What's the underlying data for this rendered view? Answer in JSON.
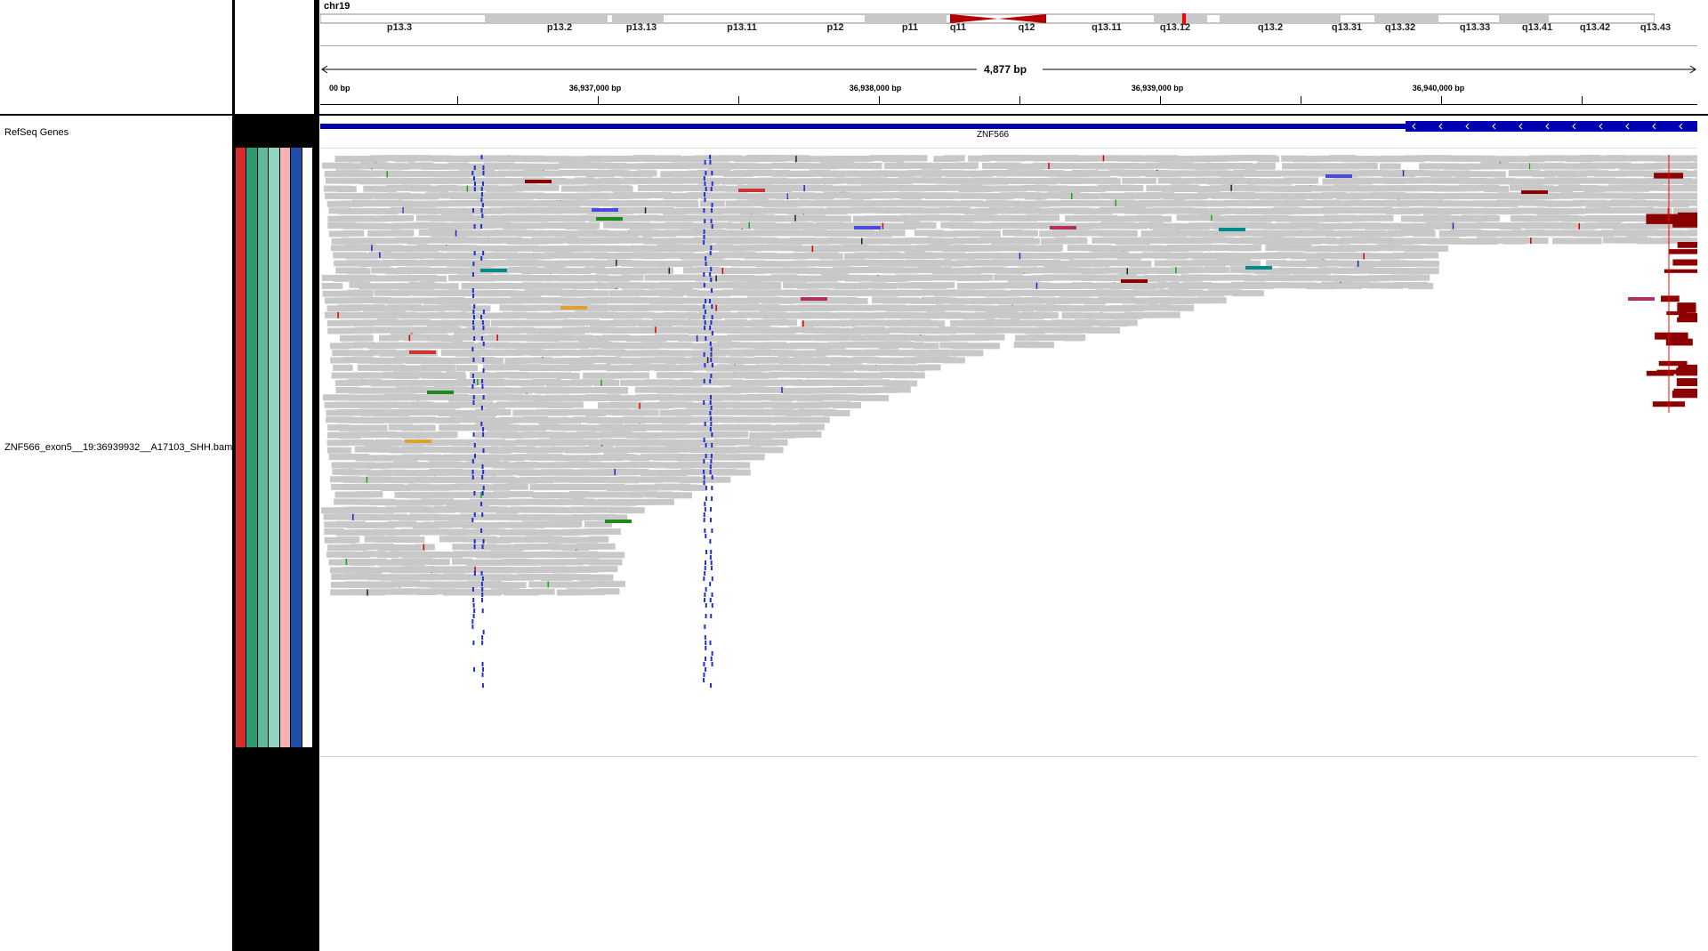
{
  "chromosome": "chr19",
  "cytobands": [
    "p13.3",
    "p13.2",
    "p13.13",
    "p13.11",
    "p12",
    "p11",
    "q11",
    "q12",
    "q13.11",
    "q13.12",
    "q13.2",
    "q13.31",
    "q13.32",
    "q13.33",
    "q13.41",
    "q13.42",
    "q13.43"
  ],
  "ruler": {
    "span_label": "4,877 bp",
    "ticks": [
      "00 bp",
      "36,937,000 bp",
      "36,938,000 bp",
      "36,939,000 bp",
      "36,940,000 bp"
    ]
  },
  "tracks": {
    "gene_track_name": "RefSeq Genes",
    "gene_name": "ZNF566",
    "alignment_track_name": "ZNF566_exon5__19:36939932__A17103_SHH.bam"
  },
  "colors": {
    "gene": "#0000b2",
    "read": "#c8c8c8",
    "centromere": "#b40000",
    "indicator": "#ff0000",
    "attr_red": "#d82b2b",
    "attr_green": "#2e9a6e",
    "attr_mint": "#8fd3c0",
    "attr_pink": "#f4b3b0",
    "attr_blue": "#1f4fa8",
    "mismatch_blue": "#2030d0"
  }
}
